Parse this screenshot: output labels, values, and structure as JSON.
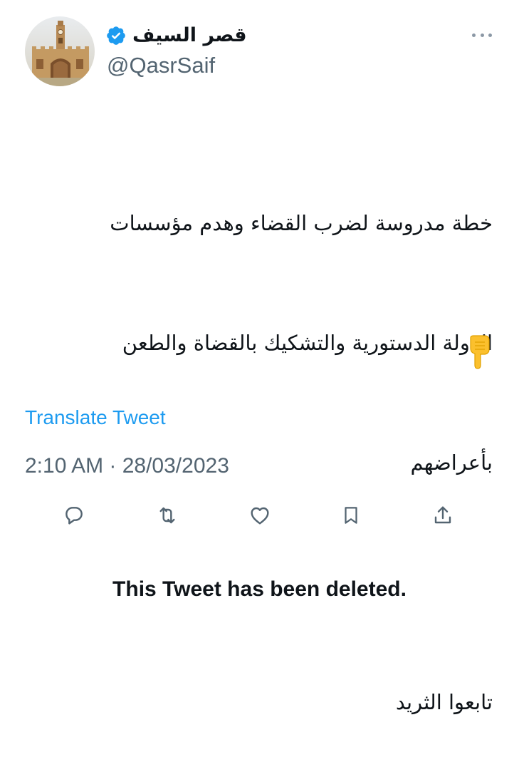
{
  "author": {
    "display_name": "قصر السيف",
    "handle": "@QasrSaif",
    "verified": true,
    "avatar_icon": "palace-clock-tower-avatar"
  },
  "tweet": {
    "lines": [
      "خطة مدروسة لضرب القضاء وهدم مؤسسات",
      "الدولة الدستورية والتشكيك بالقضاة والطعن",
      "بأعراضهم",
      "",
      "تابعوا الثريد"
    ],
    "emoji": "👇",
    "translate_label": "Translate Tweet",
    "timestamp": "2:10 AM · 28/03/2023"
  },
  "actions": {
    "reply_icon": "reply-icon",
    "retweet_icon": "retweet-icon",
    "like_icon": "like-icon",
    "bookmark_icon": "bookmark-icon",
    "share_icon": "share-icon"
  },
  "quoted_notice": "This Tweet has been deleted.",
  "colors": {
    "accent": "#1d9bf0",
    "secondary_text": "#536471",
    "primary_text": "#0f1419",
    "icon": "#536471"
  }
}
